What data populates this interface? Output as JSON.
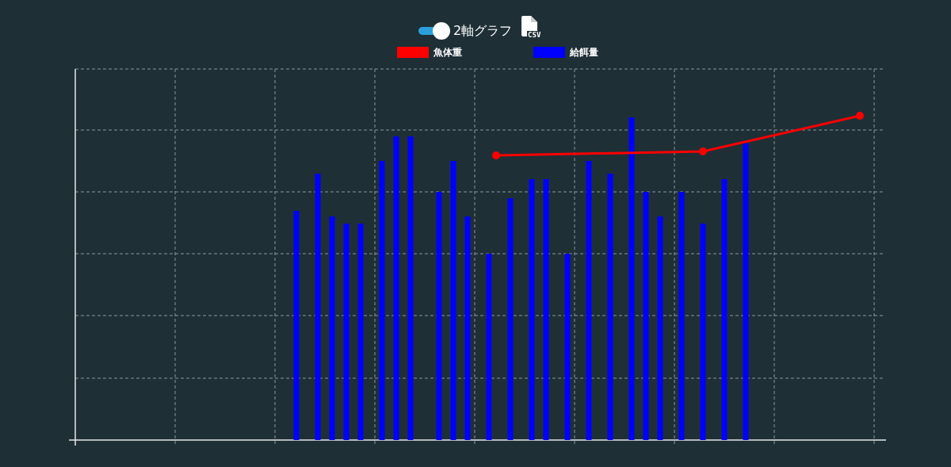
{
  "toolbar": {
    "toggle": {
      "label": "2軸グラフ",
      "on": true
    },
    "csv_button": {
      "label": "CSV"
    }
  },
  "legend": [
    {
      "name": "魚体重",
      "color": "#ff0000",
      "kind": "line"
    },
    {
      "name": "給餌量",
      "color": "#0000ff",
      "kind": "bar"
    }
  ]
}
